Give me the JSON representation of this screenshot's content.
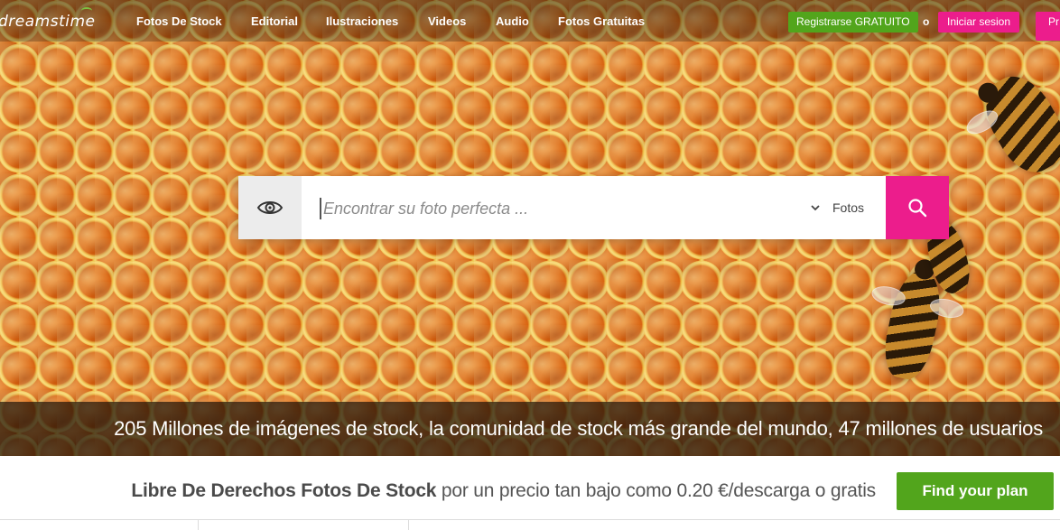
{
  "header": {
    "logo": "dreamstime",
    "nav": [
      "Fotos De Stock",
      "Editorial",
      "Ilustraciones",
      "Videos",
      "Audio",
      "Fotos Gratuitas"
    ],
    "register_label": "Registrarse GRATUITO",
    "or_label": "o",
    "login_label": "Iniciar sesion",
    "pro_label": "Pr"
  },
  "search": {
    "placeholder": "Encontrar su foto perfecta ...",
    "type_selected": "Fotos"
  },
  "hero": {
    "stats_text": "205 Millones de imágenes de stock, la comunidad de stock más grande del mundo, 47 millones de usuarios"
  },
  "pricing": {
    "strong": "Libre De Derechos Fotos De Stock",
    "rest": " por un precio tan bajo como 0.20 €/descarga o gratis",
    "cta": "Find your plan"
  },
  "colors": {
    "accent_pink": "#ec1d8c",
    "accent_green": "#52a51c"
  },
  "icons": [
    "eye-icon",
    "search-icon",
    "chevron-down-icon"
  ]
}
